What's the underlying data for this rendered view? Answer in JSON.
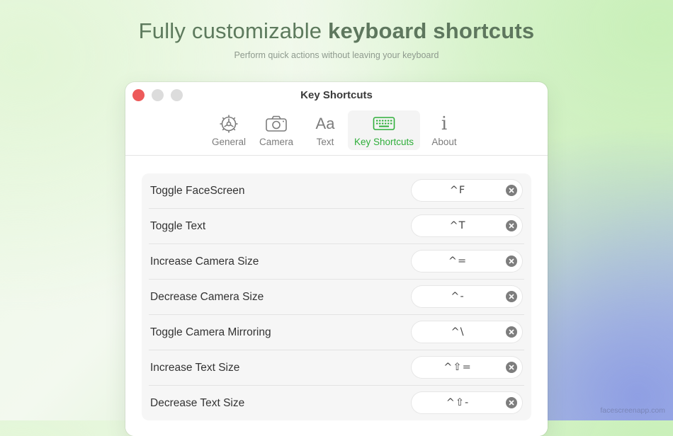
{
  "headline": {
    "prefix": "Fully customizable ",
    "bold": "keyboard shortcuts"
  },
  "subheadline": "Perform quick actions without leaving your keyboard",
  "watermark": "facescreenapp.com",
  "window": {
    "title": "Key Shortcuts",
    "tabs": [
      {
        "label": "General",
        "icon": "gear-icon",
        "active": false
      },
      {
        "label": "Camera",
        "icon": "camera-icon",
        "active": false
      },
      {
        "label": "Text",
        "icon": "text-aa-icon",
        "icon_glyph": "Aa",
        "active": false
      },
      {
        "label": "Key Shortcuts",
        "icon": "keyboard-icon",
        "active": true
      },
      {
        "label": "About",
        "icon": "info-icon",
        "icon_glyph": "i",
        "active": false
      }
    ]
  },
  "shortcuts": [
    {
      "action": "Toggle FaceScreen",
      "keys": "^F"
    },
    {
      "action": "Toggle Text",
      "keys": "^T"
    },
    {
      "action": "Increase Camera Size",
      "keys": "^="
    },
    {
      "action": "Decrease Camera Size",
      "keys": "^-"
    },
    {
      "action": "Toggle Camera Mirroring",
      "keys": "^\\"
    },
    {
      "action": "Increase Text Size",
      "keys": "^⇧="
    },
    {
      "action": "Decrease Text Size",
      "keys": "^⇧-"
    }
  ],
  "colors": {
    "accent_green": "#2fae3a",
    "close_red": "#ed5a5a",
    "headline_green": "#5d7a5d"
  }
}
